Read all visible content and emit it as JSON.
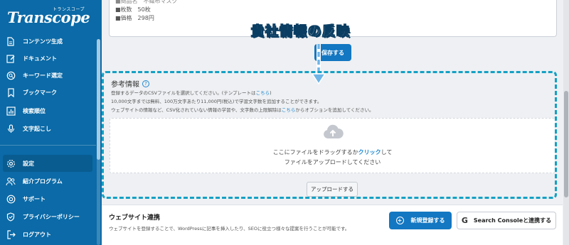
{
  "app": {
    "logo": "Transcope",
    "logo_sub": "トランスコープ"
  },
  "sidebar": {
    "items": [
      {
        "label": "コンテンツ生成",
        "icon": "document-icon"
      },
      {
        "label": "ドキュメント",
        "icon": "edit-icon"
      },
      {
        "label": "キーワード選定",
        "icon": "search-icon"
      },
      {
        "label": "ブックマーク",
        "icon": "bookmark-icon"
      },
      {
        "label": "検索順位",
        "icon": "chart-icon"
      },
      {
        "label": "文字起こし",
        "icon": "microphone-icon"
      },
      {
        "label": "設定",
        "icon": "gear-icon",
        "active": true
      },
      {
        "label": "紹介プログラム",
        "icon": "users-icon"
      },
      {
        "label": "サポート",
        "icon": "support-icon"
      },
      {
        "label": "プライバシーポリシー",
        "icon": "shield-icon"
      },
      {
        "label": "ログアウト",
        "icon": "logout-icon"
      }
    ]
  },
  "company": {
    "lines": [
      "■商品名　不織布マスク",
      "■枚数　50枚",
      "■価格　298円"
    ],
    "save_label": "保存する"
  },
  "annotation": {
    "title": "貴社情報の反映"
  },
  "reference": {
    "title": "参考情報",
    "desc1_pre": "登録するデータのCSVファイルを選択してください。(テンプレートは",
    "desc1_link": "こちら",
    "desc1_post": ")",
    "desc2": "10,000文字までは無料、100万文字あたり11,000円(税込)で学習文字数を追加することができます。",
    "desc3_pre": "ウェブサイトの情報など、CSV化されていない情報の学習や、文字数の上限解除は",
    "desc3_link": "こちら",
    "desc3_post": "からオプションを追加してください。",
    "drop_pre": "ここにファイルをドラッグするか",
    "drop_link": "クリック",
    "drop_post": "して",
    "drop_line2": "ファイルをアップロードしてください",
    "upload_label": "アップロードする"
  },
  "website": {
    "title": "ウェブサイト連携",
    "desc": "ウェブサイトを登録することで、WordPressに記事を挿入したり、SEOに役立つ様々な提案を行うことが可能です。",
    "new_label": "新規登録する",
    "gsc_label": "Search Consoleと連携する"
  },
  "colors": {
    "sidebar": "#0b6aa7",
    "primary": "#1377c2",
    "annotation_border": "#14a0c4"
  }
}
